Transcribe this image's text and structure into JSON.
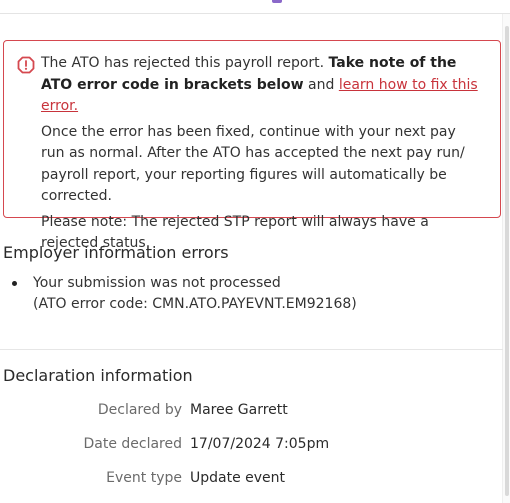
{
  "alert": {
    "line1_pre": "The ATO has rejected this payroll report. ",
    "line1_bold": "Take note of the ATO error code in brackets below",
    "line1_mid": " and ",
    "line1_link": "learn how to fix this error.",
    "paragraph2": "Once the error has been fixed, continue with your next pay run as normal. After the ATO has accepted the next pay run/ payroll report, your reporting figures will automatically be corrected.",
    "paragraph3": "Please note: The rejected STP report will always have a rejected status.",
    "icon": "alert-octagon-icon",
    "accent_color": "#d5484f"
  },
  "employer_errors": {
    "heading": "Employer information errors",
    "items": [
      {
        "message": "Your submission was not processed",
        "code": "(ATO error code: CMN.ATO.PAYEVNT.EM92168)"
      }
    ]
  },
  "declaration": {
    "heading": "Declaration information",
    "rows": [
      {
        "label": "Declared by",
        "value": "Maree Garrett"
      },
      {
        "label": "Date declared",
        "value": "17/07/2024 7:05pm"
      },
      {
        "label": "Event type",
        "value": "Update event"
      }
    ]
  }
}
